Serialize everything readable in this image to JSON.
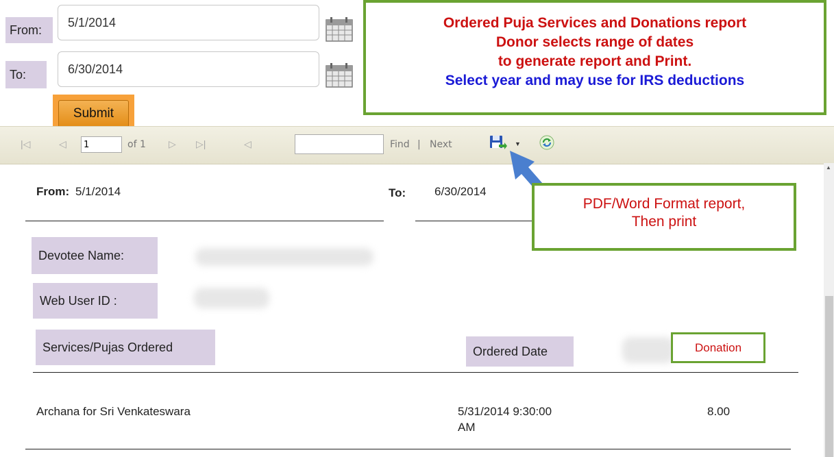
{
  "form": {
    "from_label": "From:",
    "from_value": "5/1/2014",
    "to_label": "To:",
    "to_value": "6/30/2014",
    "submit_label": "Submit"
  },
  "callout_top": {
    "line1": "Ordered Puja Services and Donations report",
    "line2": "Donor selects range of dates",
    "line3": "to generate report and Print.",
    "line4": "Select year and may use for IRS deductions"
  },
  "toolbar": {
    "page_value": "1",
    "of_pages": "of 1",
    "find_value": "",
    "find_label": "Find",
    "separator": "|",
    "next_label": "Next"
  },
  "callout_export": {
    "line1": "PDF/Word Format report,",
    "line2": "Then print"
  },
  "report": {
    "from_label": "From:",
    "from_value": "5/1/2014",
    "to_label": "To:",
    "to_value": "6/30/2014",
    "devotee_label": "Devotee Name:",
    "webuser_label": "Web User ID :",
    "col_services": "Services/Pujas Ordered",
    "col_date": "Ordered Date",
    "col_donation": "Donation",
    "rows": [
      {
        "service": "Archana for Sri Venkateswara",
        "date_line1": "5/31/2014 9:30:00",
        "date_line2": "AM",
        "amount": "8.00"
      }
    ]
  },
  "colors": {
    "label_bg": "#d9cfe3",
    "callout_border": "#6aa332",
    "callout_red": "#cc1111",
    "callout_blue": "#1a1ad6",
    "submit_highlight": "#f7a13a",
    "arrow": "#4a7fcf"
  },
  "icons": [
    "calendar-icon",
    "first-page-icon",
    "prev-page-icon",
    "next-page-icon",
    "last-page-icon",
    "back-icon",
    "save-export-icon",
    "dropdown-arrow-icon",
    "refresh-icon",
    "pointer-arrow"
  ]
}
